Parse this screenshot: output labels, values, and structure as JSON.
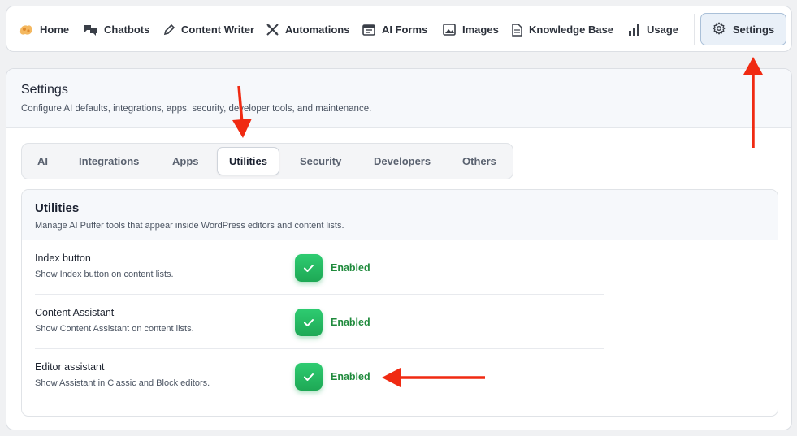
{
  "nav": {
    "items": [
      {
        "label": "Home",
        "icon": "puffer-logo-icon"
      },
      {
        "label": "Chatbots",
        "icon": "chat-bubbles-icon"
      },
      {
        "label": "Content Writer",
        "icon": "pencil-icon"
      },
      {
        "label": "Automations",
        "icon": "airplane-icon"
      },
      {
        "label": "AI Forms",
        "icon": "form-icon"
      },
      {
        "label": "Images",
        "icon": "image-icon"
      },
      {
        "label": "Knowledge Base",
        "icon": "document-icon"
      },
      {
        "label": "Usage",
        "icon": "bar-chart-icon"
      }
    ],
    "settings": {
      "label": "Settings",
      "icon": "gear-icon"
    }
  },
  "header": {
    "title": "Settings",
    "subtitle": "Configure AI defaults, integrations, apps, security, developer tools, and maintenance."
  },
  "tabs": [
    "AI",
    "Integrations",
    "Apps",
    "Utilities",
    "Security",
    "Developers",
    "Others"
  ],
  "active_tab": "Utilities",
  "card": {
    "title": "Utilities",
    "subtitle": "Manage AI Puffer tools that appear inside WordPress editors and content lists.",
    "rows": [
      {
        "label": "Index button",
        "description": "Show Index button on content lists.",
        "status": "Enabled"
      },
      {
        "label": "Content Assistant",
        "description": "Show Content Assistant on content lists.",
        "status": "Enabled"
      },
      {
        "label": "Editor assistant",
        "description": "Show Assistant in Classic and Block editors.",
        "status": "Enabled"
      }
    ]
  },
  "colors": {
    "accent_green": "#22b85c",
    "annotation_red": "#f02a12",
    "active_settings_bg": "#e9f0f8"
  }
}
